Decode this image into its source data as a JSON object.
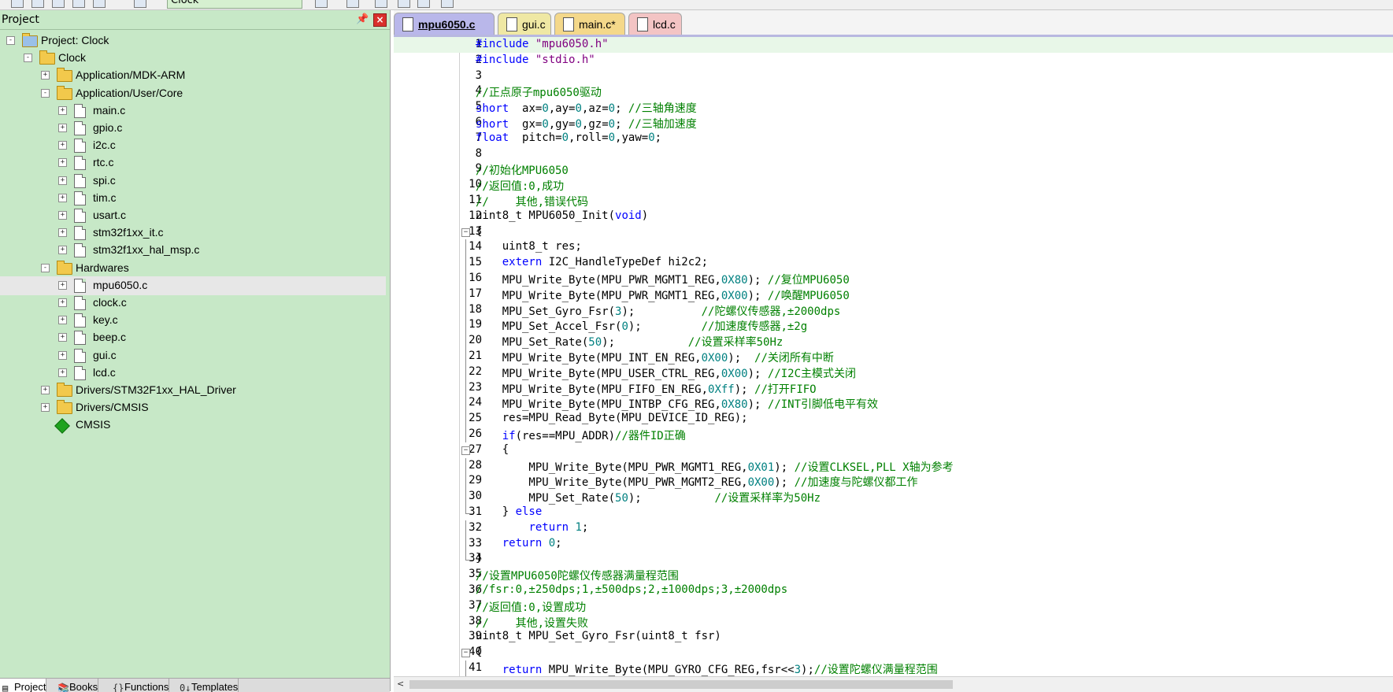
{
  "toolbar": {
    "target_select": "Clock"
  },
  "project_panel": {
    "title": "Project",
    "pin_glyph": "📌",
    "close_glyph": "×",
    "tree": [
      {
        "label": "Project: Clock",
        "type": "project",
        "level": 0,
        "expander": "-"
      },
      {
        "label": "Clock",
        "type": "target",
        "level": 1,
        "expander": "-"
      },
      {
        "label": "Application/MDK-ARM",
        "type": "folder",
        "level": 2,
        "expander": "+"
      },
      {
        "label": "Application/User/Core",
        "type": "folder",
        "level": 2,
        "expander": "-"
      },
      {
        "label": "main.c",
        "type": "file",
        "level": 3,
        "expander": "+"
      },
      {
        "label": "gpio.c",
        "type": "file",
        "level": 3,
        "expander": "+"
      },
      {
        "label": "i2c.c",
        "type": "file",
        "level": 3,
        "expander": "+"
      },
      {
        "label": "rtc.c",
        "type": "file",
        "level": 3,
        "expander": "+"
      },
      {
        "label": "spi.c",
        "type": "file",
        "level": 3,
        "expander": "+"
      },
      {
        "label": "tim.c",
        "type": "file",
        "level": 3,
        "expander": "+"
      },
      {
        "label": "usart.c",
        "type": "file",
        "level": 3,
        "expander": "+"
      },
      {
        "label": "stm32f1xx_it.c",
        "type": "file",
        "level": 3,
        "expander": "+"
      },
      {
        "label": "stm32f1xx_hal_msp.c",
        "type": "file",
        "level": 3,
        "expander": "+"
      },
      {
        "label": "Hardwares",
        "type": "folder",
        "level": 2,
        "expander": "-"
      },
      {
        "label": "mpu6050.c",
        "type": "file",
        "level": 3,
        "expander": "+",
        "selected": true
      },
      {
        "label": "clock.c",
        "type": "file",
        "level": 3,
        "expander": "+"
      },
      {
        "label": "key.c",
        "type": "file",
        "level": 3,
        "expander": "+"
      },
      {
        "label": "beep.c",
        "type": "file",
        "level": 3,
        "expander": "+"
      },
      {
        "label": "gui.c",
        "type": "file",
        "level": 3,
        "expander": "+"
      },
      {
        "label": "lcd.c",
        "type": "file",
        "level": 3,
        "expander": "+"
      },
      {
        "label": "Drivers/STM32F1xx_HAL_Driver",
        "type": "folder",
        "level": 2,
        "expander": "+"
      },
      {
        "label": "Drivers/CMSIS",
        "type": "folder",
        "level": 2,
        "expander": "+"
      },
      {
        "label": "CMSIS",
        "type": "component",
        "level": 2,
        "expander": ""
      }
    ],
    "bottom_tabs": [
      {
        "label": "Project",
        "icon": "▤",
        "active": true
      },
      {
        "label": "Books",
        "icon": "📚",
        "active": false
      },
      {
        "label": "Functions",
        "icon": "{}",
        "active": false
      },
      {
        "label": "Templates",
        "icon": "0↓",
        "active": false
      }
    ]
  },
  "editor": {
    "tabs": [
      {
        "label": "mpu6050.c",
        "style": "active"
      },
      {
        "label": "gui.c",
        "style": "yellow"
      },
      {
        "label": "main.c*",
        "style": "yellow2"
      },
      {
        "label": "lcd.c",
        "style": "pink"
      }
    ],
    "scroll_left_glyph": "<",
    "lines": [
      {
        "n": "1",
        "fold": "",
        "current": true,
        "seg": [
          [
            "kw",
            "#include "
          ],
          [
            "st",
            "\"mpu6050.h\""
          ]
        ]
      },
      {
        "n": "2",
        "fold": "",
        "seg": [
          [
            "kw",
            "#include "
          ],
          [
            "st",
            "\"stdio.h\""
          ]
        ]
      },
      {
        "n": "3",
        "fold": "",
        "seg": []
      },
      {
        "n": "4",
        "fold": "",
        "seg": [
          [
            "cm",
            "//正点原子mpu6050驱动"
          ]
        ]
      },
      {
        "n": "5",
        "fold": "",
        "seg": [
          [
            "kw",
            "short"
          ],
          [
            "",
            "  ax="
          ],
          [
            "nm",
            "0"
          ],
          [
            "",
            ",ay="
          ],
          [
            "nm",
            "0"
          ],
          [
            "",
            ",az="
          ],
          [
            "nm",
            "0"
          ],
          [
            "",
            "; "
          ],
          [
            "cm",
            "//三轴角速度"
          ]
        ]
      },
      {
        "n": "6",
        "fold": "",
        "seg": [
          [
            "kw",
            "short"
          ],
          [
            "",
            "  gx="
          ],
          [
            "nm",
            "0"
          ],
          [
            "",
            ",gy="
          ],
          [
            "nm",
            "0"
          ],
          [
            "",
            ",gz="
          ],
          [
            "nm",
            "0"
          ],
          [
            "",
            "; "
          ],
          [
            "cm",
            "//三轴加速度"
          ]
        ]
      },
      {
        "n": "7",
        "fold": "",
        "seg": [
          [
            "kw",
            "float"
          ],
          [
            "",
            "  pitch="
          ],
          [
            "nm",
            "0"
          ],
          [
            "",
            ",roll="
          ],
          [
            "nm",
            "0"
          ],
          [
            "",
            ",yaw="
          ],
          [
            "nm",
            "0"
          ],
          [
            "",
            ";"
          ]
        ]
      },
      {
        "n": "8",
        "fold": "",
        "seg": []
      },
      {
        "n": "9",
        "fold": "",
        "seg": [
          [
            "cm",
            "//初始化MPU6050"
          ]
        ]
      },
      {
        "n": "10",
        "fold": "",
        "seg": [
          [
            "cm",
            "//返回值:0,成功"
          ]
        ]
      },
      {
        "n": "11",
        "fold": "",
        "seg": [
          [
            "cm",
            "//    其他,错误代码"
          ]
        ]
      },
      {
        "n": "12",
        "fold": "",
        "seg": [
          [
            "",
            "uint8_t MPU6050_Init("
          ],
          [
            "kw",
            "void"
          ],
          [
            "",
            ")"
          ]
        ]
      },
      {
        "n": "13",
        "fold": "box",
        "seg": [
          [
            "",
            "{"
          ]
        ]
      },
      {
        "n": "14",
        "fold": "line",
        "seg": [
          [
            "",
            "    uint8_t res;"
          ]
        ]
      },
      {
        "n": "15",
        "fold": "line",
        "seg": [
          [
            "",
            "    "
          ],
          [
            "kw",
            "extern"
          ],
          [
            "",
            " I2C_HandleTypeDef hi2c2;"
          ]
        ]
      },
      {
        "n": "16",
        "fold": "line",
        "seg": [
          [
            "",
            "    MPU_Write_Byte(MPU_PWR_MGMT1_REG,"
          ],
          [
            "nm",
            "0X80"
          ],
          [
            "",
            "); "
          ],
          [
            "cm",
            "//复位MPU6050"
          ]
        ]
      },
      {
        "n": "17",
        "fold": "line",
        "seg": [
          [
            "",
            "    MPU_Write_Byte(MPU_PWR_MGMT1_REG,"
          ],
          [
            "nm",
            "0X00"
          ],
          [
            "",
            "); "
          ],
          [
            "cm",
            "//唤醒MPU6050"
          ]
        ]
      },
      {
        "n": "18",
        "fold": "line",
        "seg": [
          [
            "",
            "    MPU_Set_Gyro_Fsr("
          ],
          [
            "nm",
            "3"
          ],
          [
            "",
            ");          "
          ],
          [
            "cm",
            "//陀螺仪传感器,±2000dps"
          ]
        ]
      },
      {
        "n": "19",
        "fold": "line",
        "seg": [
          [
            "",
            "    MPU_Set_Accel_Fsr("
          ],
          [
            "nm",
            "0"
          ],
          [
            "",
            ");         "
          ],
          [
            "cm",
            "//加速度传感器,±2g"
          ]
        ]
      },
      {
        "n": "20",
        "fold": "line",
        "seg": [
          [
            "",
            "    MPU_Set_Rate("
          ],
          [
            "nm",
            "50"
          ],
          [
            "",
            ");           "
          ],
          [
            "cm",
            "//设置采样率50Hz"
          ]
        ]
      },
      {
        "n": "21",
        "fold": "line",
        "seg": [
          [
            "",
            "    MPU_Write_Byte(MPU_INT_EN_REG,"
          ],
          [
            "nm",
            "0X00"
          ],
          [
            "",
            ");  "
          ],
          [
            "cm",
            "//关闭所有中断"
          ]
        ]
      },
      {
        "n": "22",
        "fold": "line",
        "seg": [
          [
            "",
            "    MPU_Write_Byte(MPU_USER_CTRL_REG,"
          ],
          [
            "nm",
            "0X00"
          ],
          [
            "",
            "); "
          ],
          [
            "cm",
            "//I2C主模式关闭"
          ]
        ]
      },
      {
        "n": "23",
        "fold": "line",
        "seg": [
          [
            "",
            "    MPU_Write_Byte(MPU_FIFO_EN_REG,"
          ],
          [
            "nm",
            "0Xff"
          ],
          [
            "",
            "); "
          ],
          [
            "cm",
            "//打开FIFO"
          ]
        ]
      },
      {
        "n": "24",
        "fold": "line",
        "seg": [
          [
            "",
            "    MPU_Write_Byte(MPU_INTBP_CFG_REG,"
          ],
          [
            "nm",
            "0X80"
          ],
          [
            "",
            "); "
          ],
          [
            "cm",
            "//INT引脚低电平有效"
          ]
        ]
      },
      {
        "n": "25",
        "fold": "line",
        "seg": [
          [
            "",
            "    res=MPU_Read_Byte(MPU_DEVICE_ID_REG);"
          ]
        ]
      },
      {
        "n": "26",
        "fold": "line",
        "seg": [
          [
            "",
            "    "
          ],
          [
            "kw",
            "if"
          ],
          [
            "",
            "(res==MPU_ADDR)"
          ],
          [
            "cm",
            "//器件ID正确"
          ]
        ]
      },
      {
        "n": "27",
        "fold": "box",
        "seg": [
          [
            "",
            "    {"
          ]
        ]
      },
      {
        "n": "28",
        "fold": "line",
        "seg": [
          [
            "",
            "        MPU_Write_Byte(MPU_PWR_MGMT1_REG,"
          ],
          [
            "nm",
            "0X01"
          ],
          [
            "",
            "); "
          ],
          [
            "cm",
            "//设置CLKSEL,PLL X轴为参考"
          ]
        ]
      },
      {
        "n": "29",
        "fold": "line",
        "seg": [
          [
            "",
            "        MPU_Write_Byte(MPU_PWR_MGMT2_REG,"
          ],
          [
            "nm",
            "0X00"
          ],
          [
            "",
            "); "
          ],
          [
            "cm",
            "//加速度与陀螺仪都工作"
          ]
        ]
      },
      {
        "n": "30",
        "fold": "line",
        "seg": [
          [
            "",
            "        MPU_Set_Rate("
          ],
          [
            "nm",
            "50"
          ],
          [
            "",
            ");           "
          ],
          [
            "cm",
            "//设置采样率为50Hz"
          ]
        ]
      },
      {
        "n": "31",
        "fold": "end",
        "seg": [
          [
            "",
            "    } "
          ],
          [
            "kw",
            "else"
          ]
        ]
      },
      {
        "n": "32",
        "fold": "line",
        "seg": [
          [
            "",
            "        "
          ],
          [
            "kw",
            "return"
          ],
          [
            "",
            " "
          ],
          [
            "nm",
            "1"
          ],
          [
            "",
            ";"
          ]
        ]
      },
      {
        "n": "33",
        "fold": "line",
        "seg": [
          [
            "",
            "    "
          ],
          [
            "kw",
            "return"
          ],
          [
            "",
            " "
          ],
          [
            "nm",
            "0"
          ],
          [
            "",
            ";"
          ]
        ]
      },
      {
        "n": "34",
        "fold": "end",
        "seg": [
          [
            "",
            "}"
          ]
        ]
      },
      {
        "n": "35",
        "fold": "",
        "seg": [
          [
            "cm",
            "//设置MPU6050陀螺仪传感器满量程范围"
          ]
        ]
      },
      {
        "n": "36",
        "fold": "",
        "seg": [
          [
            "cm",
            "//fsr:0,±250dps;1,±500dps;2,±1000dps;3,±2000dps"
          ]
        ]
      },
      {
        "n": "37",
        "fold": "",
        "seg": [
          [
            "cm",
            "//返回值:0,设置成功"
          ]
        ]
      },
      {
        "n": "38",
        "fold": "",
        "seg": [
          [
            "cm",
            "//    其他,设置失败"
          ]
        ]
      },
      {
        "n": "39",
        "fold": "",
        "seg": [
          [
            "",
            "uint8_t MPU_Set_Gyro_Fsr(uint8_t fsr)"
          ]
        ]
      },
      {
        "n": "40",
        "fold": "box",
        "seg": [
          [
            "",
            "{"
          ]
        ]
      },
      {
        "n": "41",
        "fold": "line",
        "seg": [
          [
            "",
            "    "
          ],
          [
            "kw",
            "return"
          ],
          [
            "",
            " MPU_Write_Byte(MPU_GYRO_CFG_REG,fsr<<"
          ],
          [
            "nm",
            "3"
          ],
          [
            "",
            ");"
          ],
          [
            "cm",
            "//设置陀螺仪满量程范围"
          ]
        ]
      }
    ]
  }
}
